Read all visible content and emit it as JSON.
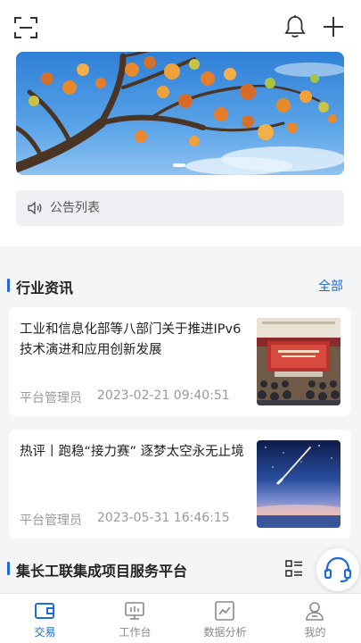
{
  "header": {
    "scan_icon": "scan-icon",
    "bell_icon": "bell-icon",
    "plus_icon": "plus-icon"
  },
  "notice": {
    "text": "公告列表",
    "icon": "speaker-icon"
  },
  "news_section": {
    "title": "行业资讯",
    "all_label": "全部"
  },
  "news": [
    {
      "title": "工业和信息化部等八部门关于推进IPv6技术演进和应用创新发展",
      "author": "平台管理员",
      "date": "2023-02-21 09:40:51"
    },
    {
      "title": "热评丨跑稳“接力赛” 逐梦太空永无止境",
      "author": "平台管理员",
      "date": "2023-05-31 16:46:15"
    }
  ],
  "platform": {
    "title": "集长工联集成项目服务平台"
  },
  "nav": {
    "items": [
      {
        "label": "交易",
        "icon": "wallet-icon",
        "active": true
      },
      {
        "label": "工作台",
        "icon": "monitor-icon",
        "active": false
      },
      {
        "label": "数据分析",
        "icon": "chart-icon",
        "active": false
      },
      {
        "label": "我的",
        "icon": "user-icon",
        "active": false
      }
    ]
  },
  "colors": {
    "accent": "#1d6bd8",
    "background": "#f4f5f7"
  }
}
